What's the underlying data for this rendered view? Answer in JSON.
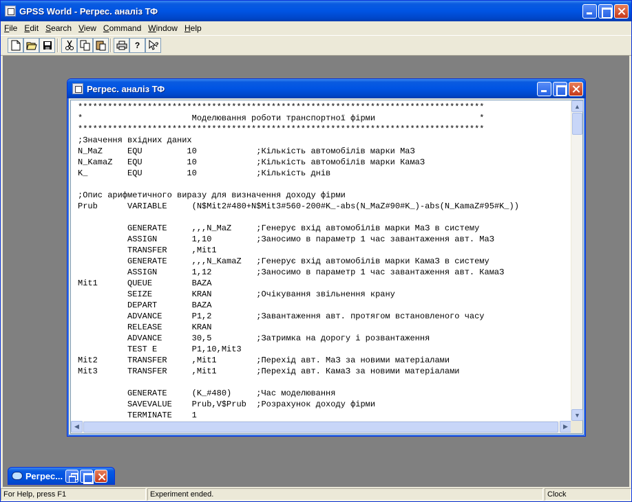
{
  "app": {
    "title": "GPSS World - Регрес. аналіз ТФ"
  },
  "menu": [
    {
      "label": "File",
      "accel": "F",
      "rest": "ile"
    },
    {
      "label": "Edit",
      "accel": "E",
      "rest": "dit"
    },
    {
      "label": "Search",
      "accel": "S",
      "rest": "earch"
    },
    {
      "label": "View",
      "accel": "V",
      "rest": "iew"
    },
    {
      "label": "Command",
      "accel": "C",
      "rest": "ommand"
    },
    {
      "label": "Window",
      "accel": "W",
      "rest": "indow"
    },
    {
      "label": "Help",
      "accel": "H",
      "rest": "elp"
    }
  ],
  "toolbar": {
    "icons": [
      "new-file-icon",
      "open-folder-icon",
      "save-icon",
      "cut-icon",
      "copy-icon",
      "paste-icon",
      "print-icon",
      "help-icon",
      "context-help-icon"
    ]
  },
  "child": {
    "title": "Регрес. аналіз ТФ",
    "code_lines": [
      "**********************************************************************************",
      "*                      Моделювання роботи транспортної фірми                     *",
      "**********************************************************************************",
      ";Значення вхідних даних",
      "N_MaZ     EQU         10            ;Кількість автомобілів марки МаЗ",
      "N_KamaZ   EQU         10            ;Кількість автомобілів марки КамаЗ",
      "K_        EQU         10            ;Кількість днів",
      "",
      ";Опис арифметичного виразу для визначення доходу фірми",
      "Prub      VARIABLE     (N$Mit2#480+N$Mit3#560-200#K_-abs(N_MaZ#90#K_)-abs(N_KamaZ#95#K_))",
      "",
      "          GENERATE     ,,,N_MaZ     ;Генерує вхід автомобілів марки МаЗ в систему",
      "          ASSIGN       1,10         ;Заносимо в параметр 1 час завантаження авт. МаЗ",
      "          TRANSFER     ,Mit1",
      "          GENERATE     ,,,N_KamaZ   ;Генерує вхід автомобілів марки КамаЗ в систему",
      "          ASSIGN       1,12         ;Заносимо в параметр 1 час завантаження авт. КамаЗ",
      "Mit1      QUEUE        BAZA",
      "          SEIZE        KRAN         ;Очікування звільнення крану",
      "          DEPART       BAZA",
      "          ADVANCE      P1,2         ;Завантаження авт. протягом встановленого часу",
      "          RELEASE      KRAN",
      "          ADVANCE      30,5         ;Затримка на дорогу і розвантаження",
      "          TEST E       P1,10,Mit3",
      "Mit2      TRANSFER     ,Mit1        ;Перехід авт. МаЗ за новими матеріалами",
      "Mit3      TRANSFER     ,Mit1        ;Перехід авт. КамаЗ за новими матеріалами",
      "",
      "          GENERATE     (K_#480)     ;Час моделювання",
      "          SAVEVALUE    Prub,V$Prub  ;Розрахунок доходу фірми",
      "          TERMINATE    1"
    ]
  },
  "minimized": {
    "title": "Регрес..."
  },
  "status": {
    "help": "For Help, press F1",
    "message": "Experiment ended.",
    "extra": "",
    "clock": "Clock"
  }
}
